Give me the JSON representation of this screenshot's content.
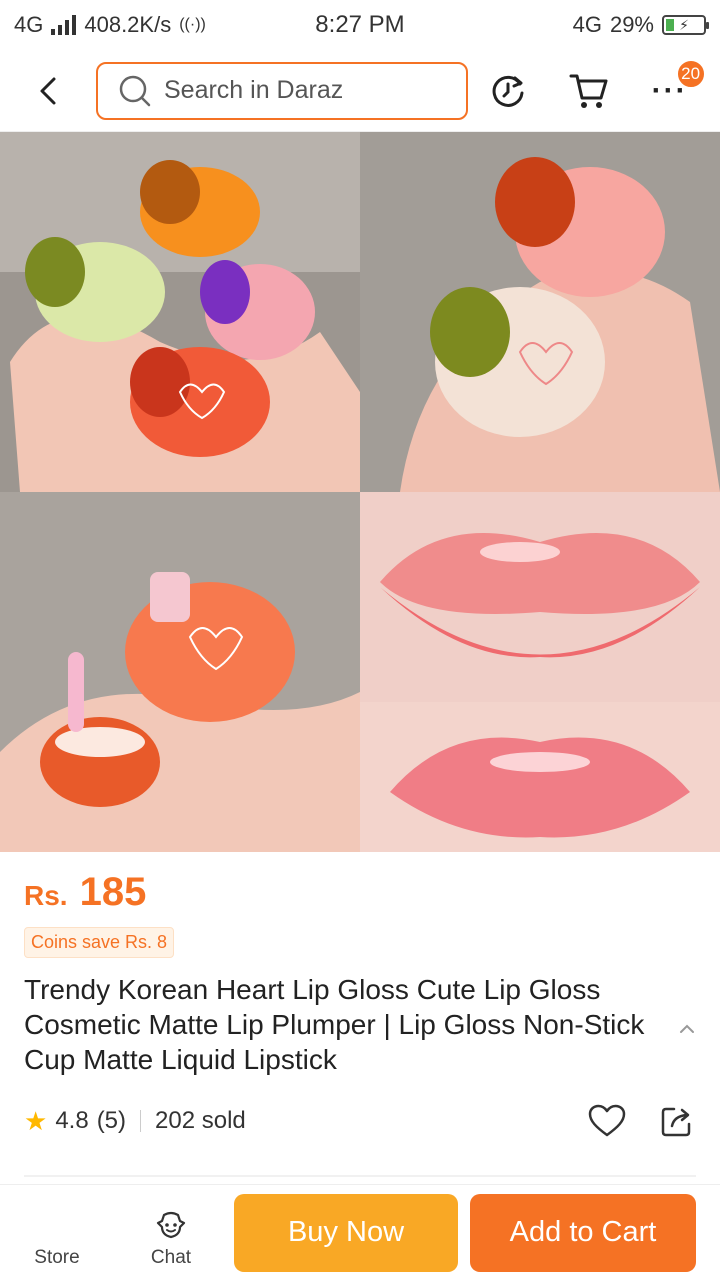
{
  "status_bar": {
    "network": "4G",
    "speed": "408.2K/s",
    "time": "8:27 PM",
    "network_right": "4G",
    "battery": "29%"
  },
  "top_bar": {
    "search_placeholder": "Search in Daraz",
    "cart_count": "20"
  },
  "product": {
    "currency": "Rs.",
    "price": "185",
    "coins_save": "Coins save Rs. 8",
    "title": "Trendy Korean Heart Lip Gloss Cute Lip Gloss Cosmetic Matte Lip Plumper | Lip Gloss Non-Stick Cup Matte Liquid Lipstick",
    "rating": "4.8",
    "reviews": "(5)",
    "sold": "202 sold"
  },
  "bottom_bar": {
    "store_label": "Store",
    "chat_label": "Chat",
    "buy_now": "Buy Now",
    "add_to_cart": "Add to Cart"
  },
  "colors": {
    "accent": "#f57224",
    "buy_now": "#f9a825",
    "star": "#ffb800"
  }
}
